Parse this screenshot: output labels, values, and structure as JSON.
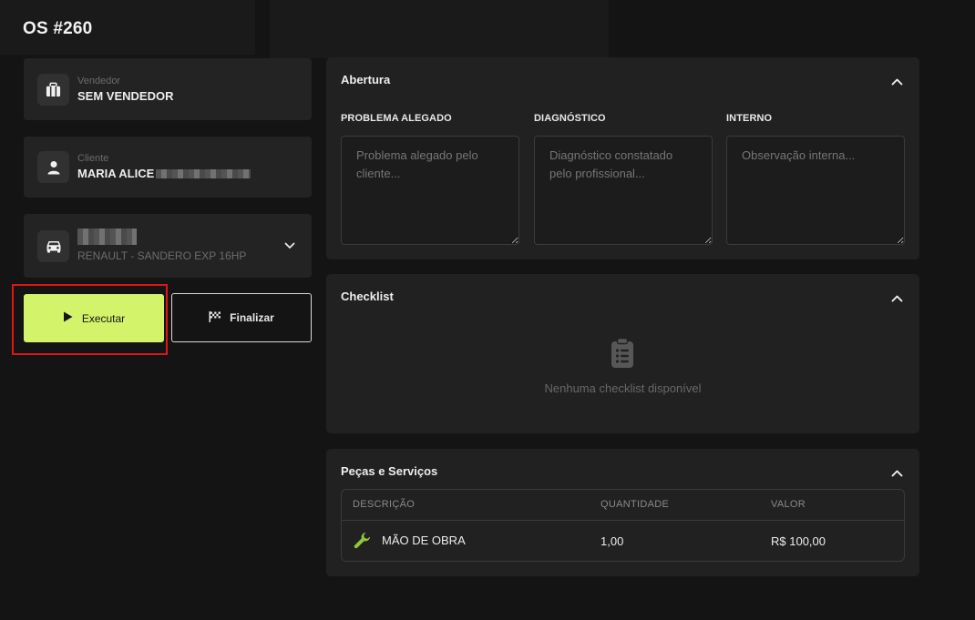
{
  "page": {
    "title": "OS #260"
  },
  "vendedor": {
    "label": "Vendedor",
    "value": "SEM VENDEDOR",
    "icon": "briefcase-icon"
  },
  "cliente": {
    "label": "Cliente",
    "value": "MARIA ALICE",
    "icon": "user-icon"
  },
  "veiculo": {
    "model": "RENAULT - SANDERO EXP 16HP",
    "icon": "car-icon"
  },
  "actions": {
    "execute_label": "Executar",
    "finalize_label": "Finalizar",
    "accent_color": "#d3f36b"
  },
  "abertura": {
    "title": "Abertura",
    "fields": [
      {
        "label": "PROBLEMA ALEGADO",
        "placeholder": "Problema alegado pelo cliente..."
      },
      {
        "label": "DIAGNÓSTICO",
        "placeholder": "Diagnóstico constatado pelo profissional..."
      },
      {
        "label": "INTERNO",
        "placeholder": "Observação interna..."
      }
    ]
  },
  "checklist": {
    "title": "Checklist",
    "empty_text": "Nenhuma checklist disponível"
  },
  "pecas": {
    "title": "Peças e Serviços",
    "columns": [
      "DESCRIÇÃO",
      "QUANTIDADE",
      "VALOR"
    ],
    "rows": [
      {
        "descricao": "MÃO DE OBRA",
        "quantidade": "1,00",
        "valor": "R$ 100,00",
        "icon": "wrench-icon"
      }
    ]
  }
}
